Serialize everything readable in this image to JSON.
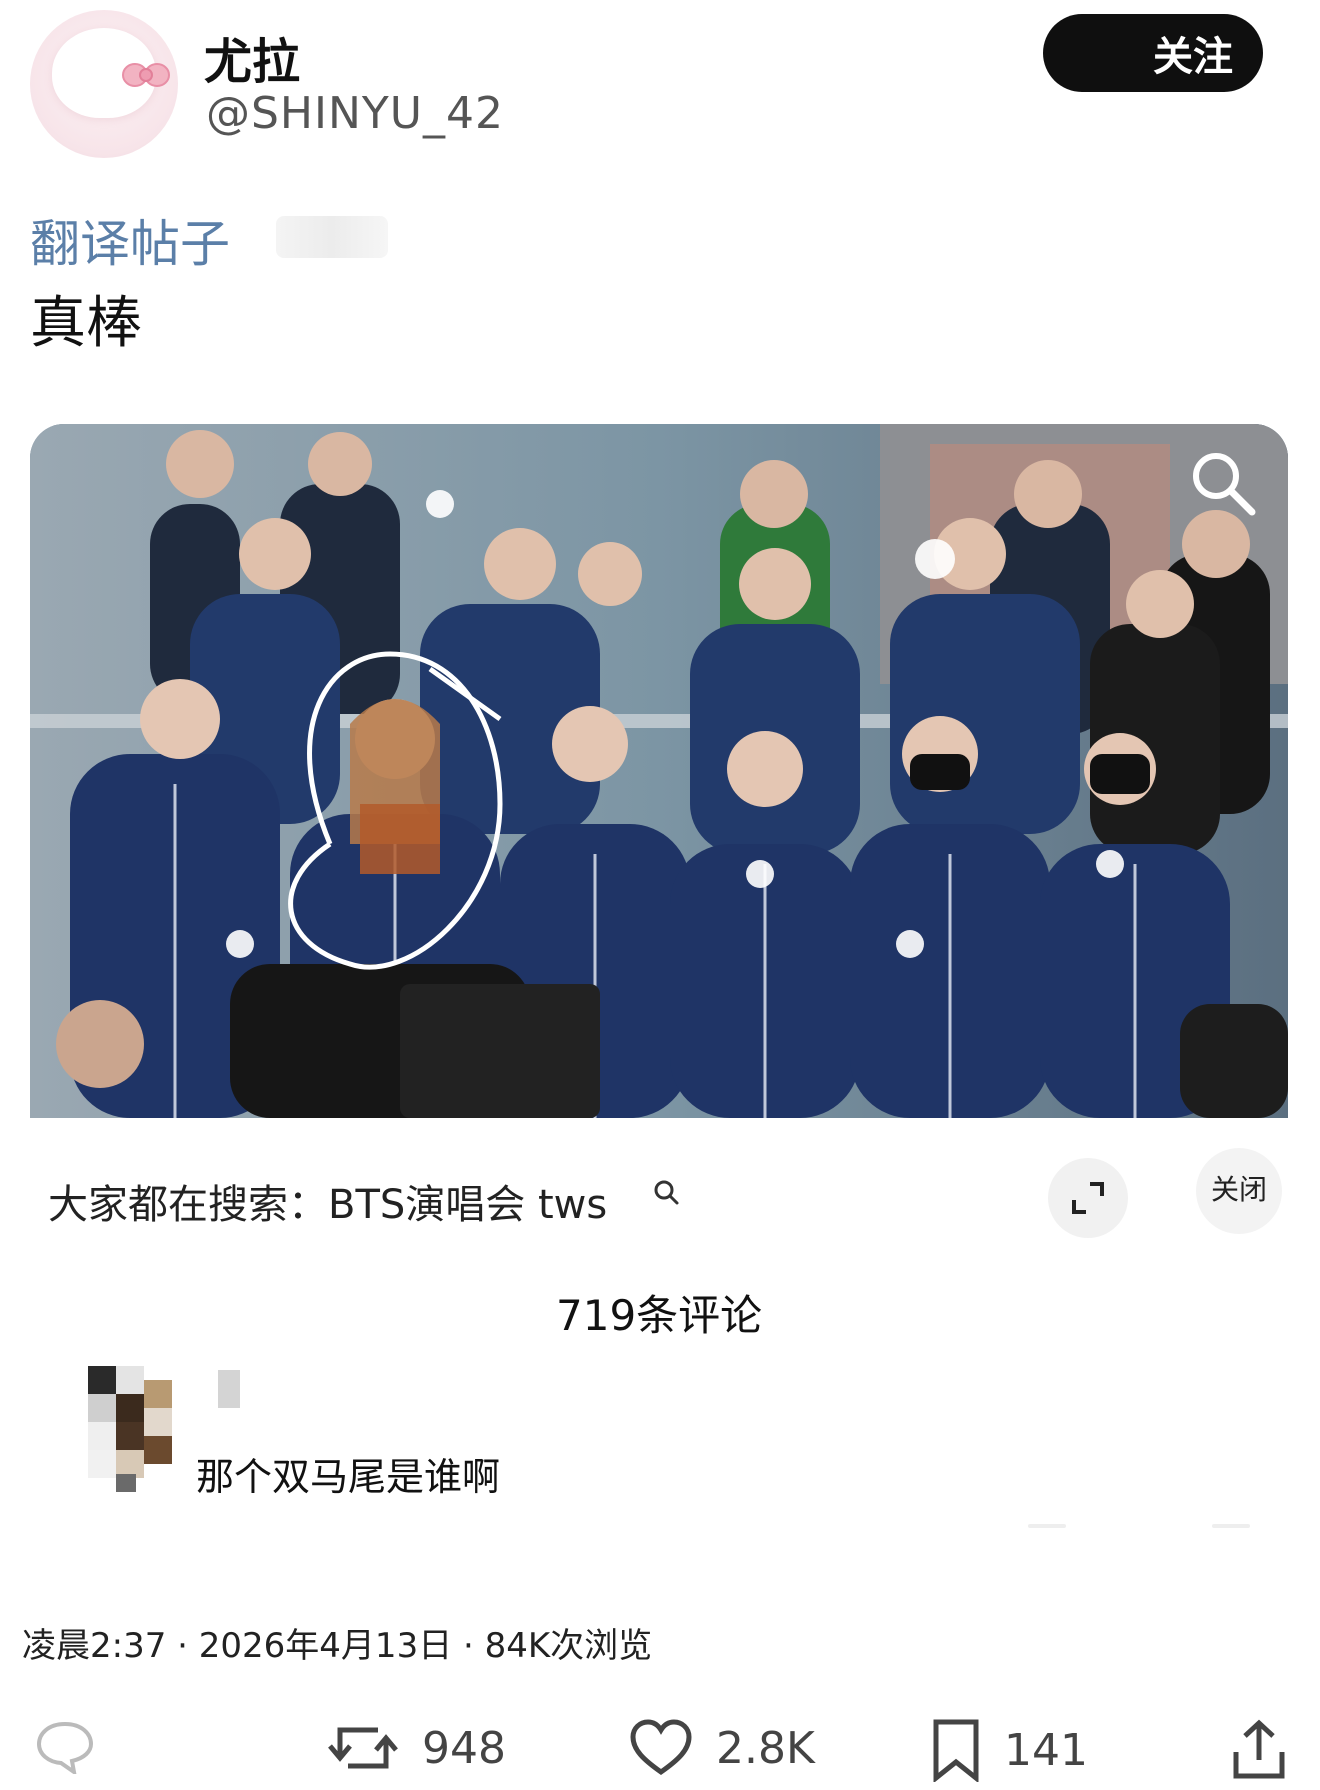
{
  "header": {
    "display_name": "尤拉",
    "handle": "@SHINYU_42",
    "follow_label": "关注"
  },
  "post": {
    "translate_label": "翻译帖子",
    "text": "真棒"
  },
  "suggestion": {
    "text": "大家都在搜索：BTS演唱会 tws",
    "close_label": "关闭"
  },
  "comments": {
    "count_label": "719条评论",
    "items": [
      {
        "text": "那个双马尾是谁啊"
      }
    ]
  },
  "meta": {
    "text": "凌晨2:37 · 2026年4月13日 · 84K次浏览"
  },
  "actions": {
    "reposts": "948",
    "likes": "2.8K",
    "bookmarks": "141"
  },
  "icons": [
    "hello-kitty-avatar-icon",
    "search-icon",
    "expand-icon",
    "comment-icon",
    "repost-icon",
    "heart-icon",
    "bookmark-icon",
    "share-icon"
  ]
}
